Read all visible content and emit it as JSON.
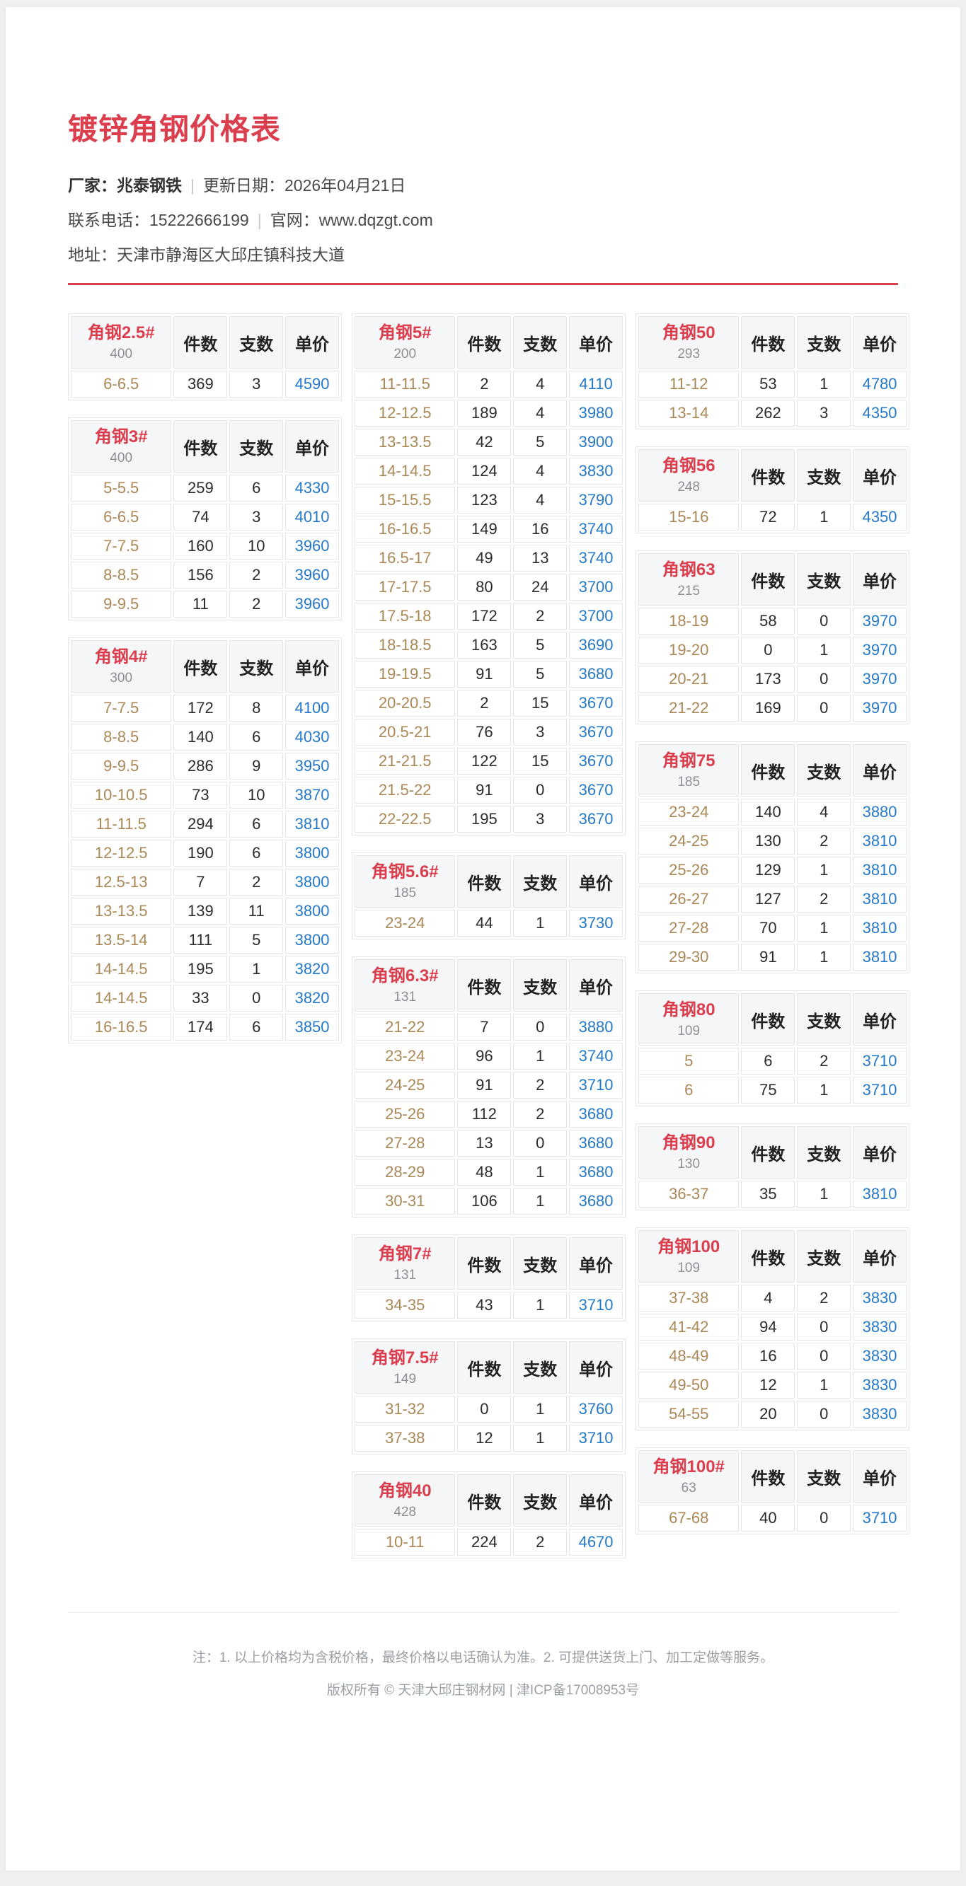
{
  "page": {
    "title": "镀锌角钢价格表",
    "meta": {
      "factory": "厂家：兆泰钢铁",
      "sep": "|",
      "update_date": "更新日期：2026年04月21日",
      "phone": "联系电话：15222666199",
      "website": "官网：www.dqzgt.com",
      "address": "地址：天津市静海区大邱庄镇科技大道"
    }
  },
  "colors": {
    "accent_red": "#db3e4d",
    "price_blue": "#2478c8",
    "range_tan": "#ab8756",
    "header_bg": "#f5f6f8",
    "border": "#e4e7ea",
    "footer_gray": "#9aa0a5"
  },
  "table_headers": [
    "件数",
    "支数",
    "单价"
  ],
  "columns": [
    {
      "tables": [
        {
          "name": "角钢2.5#",
          "subtitle": "400",
          "rows": [
            [
              "6-6.5",
              "369",
              "3",
              "4590"
            ]
          ]
        },
        {
          "name": "角钢3#",
          "subtitle": "400",
          "rows": [
            [
              "5-5.5",
              "259",
              "6",
              "4330"
            ],
            [
              "6-6.5",
              "74",
              "3",
              "4010"
            ],
            [
              "7-7.5",
              "160",
              "10",
              "3960"
            ],
            [
              "8-8.5",
              "156",
              "2",
              "3960"
            ],
            [
              "9-9.5",
              "11",
              "2",
              "3960"
            ]
          ]
        },
        {
          "name": "角钢4#",
          "subtitle": "300",
          "rows": [
            [
              "7-7.5",
              "172",
              "8",
              "4100"
            ],
            [
              "8-8.5",
              "140",
              "6",
              "4030"
            ],
            [
              "9-9.5",
              "286",
              "9",
              "3950"
            ],
            [
              "10-10.5",
              "73",
              "10",
              "3870"
            ],
            [
              "11-11.5",
              "294",
              "6",
              "3810"
            ],
            [
              "12-12.5",
              "190",
              "6",
              "3800"
            ],
            [
              "12.5-13",
              "7",
              "2",
              "3800"
            ],
            [
              "13-13.5",
              "139",
              "11",
              "3800"
            ],
            [
              "13.5-14",
              "111",
              "5",
              "3800"
            ],
            [
              "14-14.5",
              "195",
              "1",
              "3820"
            ],
            [
              "14-14.5",
              "33",
              "0",
              "3820"
            ],
            [
              "16-16.5",
              "174",
              "6",
              "3850"
            ]
          ]
        }
      ]
    },
    {
      "tables": [
        {
          "name": "角钢5#",
          "subtitle": "200",
          "rows": [
            [
              "11-11.5",
              "2",
              "4",
              "4110"
            ],
            [
              "12-12.5",
              "189",
              "4",
              "3980"
            ],
            [
              "13-13.5",
              "42",
              "5",
              "3900"
            ],
            [
              "14-14.5",
              "124",
              "4",
              "3830"
            ],
            [
              "15-15.5",
              "123",
              "4",
              "3790"
            ],
            [
              "16-16.5",
              "149",
              "16",
              "3740"
            ],
            [
              "16.5-17",
              "49",
              "13",
              "3740"
            ],
            [
              "17-17.5",
              "80",
              "24",
              "3700"
            ],
            [
              "17.5-18",
              "172",
              "2",
              "3700"
            ],
            [
              "18-18.5",
              "163",
              "5",
              "3690"
            ],
            [
              "19-19.5",
              "91",
              "5",
              "3680"
            ],
            [
              "20-20.5",
              "2",
              "15",
              "3670"
            ],
            [
              "20.5-21",
              "76",
              "3",
              "3670"
            ],
            [
              "21-21.5",
              "122",
              "15",
              "3670"
            ],
            [
              "21.5-22",
              "91",
              "0",
              "3670"
            ],
            [
              "22-22.5",
              "195",
              "3",
              "3670"
            ]
          ]
        },
        {
          "name": "角钢5.6#",
          "subtitle": "185",
          "rows": [
            [
              "23-24",
              "44",
              "1",
              "3730"
            ]
          ]
        },
        {
          "name": "角钢6.3#",
          "subtitle": "131",
          "rows": [
            [
              "21-22",
              "7",
              "0",
              "3880"
            ],
            [
              "23-24",
              "96",
              "1",
              "3740"
            ],
            [
              "24-25",
              "91",
              "2",
              "3710"
            ],
            [
              "25-26",
              "112",
              "2",
              "3680"
            ],
            [
              "27-28",
              "13",
              "0",
              "3680"
            ],
            [
              "28-29",
              "48",
              "1",
              "3680"
            ],
            [
              "30-31",
              "106",
              "1",
              "3680"
            ]
          ]
        },
        {
          "name": "角钢7#",
          "subtitle": "131",
          "rows": [
            [
              "34-35",
              "43",
              "1",
              "3710"
            ]
          ]
        },
        {
          "name": "角钢7.5#",
          "subtitle": "149",
          "rows": [
            [
              "31-32",
              "0",
              "1",
              "3760"
            ],
            [
              "37-38",
              "12",
              "1",
              "3710"
            ]
          ]
        },
        {
          "name": "角钢40",
          "subtitle": "428",
          "rows": [
            [
              "10-11",
              "224",
              "2",
              "4670"
            ]
          ]
        }
      ]
    },
    {
      "tables": [
        {
          "name": "角钢50",
          "subtitle": "293",
          "rows": [
            [
              "11-12",
              "53",
              "1",
              "4780"
            ],
            [
              "13-14",
              "262",
              "3",
              "4350"
            ]
          ]
        },
        {
          "name": "角钢56",
          "subtitle": "248",
          "rows": [
            [
              "15-16",
              "72",
              "1",
              "4350"
            ]
          ]
        },
        {
          "name": "角钢63",
          "subtitle": "215",
          "rows": [
            [
              "18-19",
              "58",
              "0",
              "3970"
            ],
            [
              "19-20",
              "0",
              "1",
              "3970"
            ],
            [
              "20-21",
              "173",
              "0",
              "3970"
            ],
            [
              "21-22",
              "169",
              "0",
              "3970"
            ]
          ]
        },
        {
          "name": "角钢75",
          "subtitle": "185",
          "rows": [
            [
              "23-24",
              "140",
              "4",
              "3880"
            ],
            [
              "24-25",
              "130",
              "2",
              "3810"
            ],
            [
              "25-26",
              "129",
              "1",
              "3810"
            ],
            [
              "26-27",
              "127",
              "2",
              "3810"
            ],
            [
              "27-28",
              "70",
              "1",
              "3810"
            ],
            [
              "29-30",
              "91",
              "1",
              "3810"
            ]
          ]
        },
        {
          "name": "角钢80",
          "subtitle": "109",
          "rows": [
            [
              "5",
              "6",
              "2",
              "3710"
            ],
            [
              "6",
              "75",
              "1",
              "3710"
            ]
          ]
        },
        {
          "name": "角钢90",
          "subtitle": "130",
          "rows": [
            [
              "36-37",
              "35",
              "1",
              "3810"
            ]
          ]
        },
        {
          "name": "角钢100",
          "subtitle": "109",
          "rows": [
            [
              "37-38",
              "4",
              "2",
              "3830"
            ],
            [
              "41-42",
              "94",
              "0",
              "3830"
            ],
            [
              "48-49",
              "16",
              "0",
              "3830"
            ],
            [
              "49-50",
              "12",
              "1",
              "3830"
            ],
            [
              "54-55",
              "20",
              "0",
              "3830"
            ]
          ]
        },
        {
          "name": "角钢100#",
          "subtitle": "63",
          "rows": [
            [
              "67-68",
              "40",
              "0",
              "3710"
            ]
          ]
        }
      ]
    }
  ],
  "footer": {
    "note": "注：1. 以上价格均为含税价格，最终价格以电话确认为准。2. 可提供送货上门、加工定做等服务。",
    "copyright": "版权所有 © 天津大邱庄钢材网 | 津ICP备17008953号"
  }
}
